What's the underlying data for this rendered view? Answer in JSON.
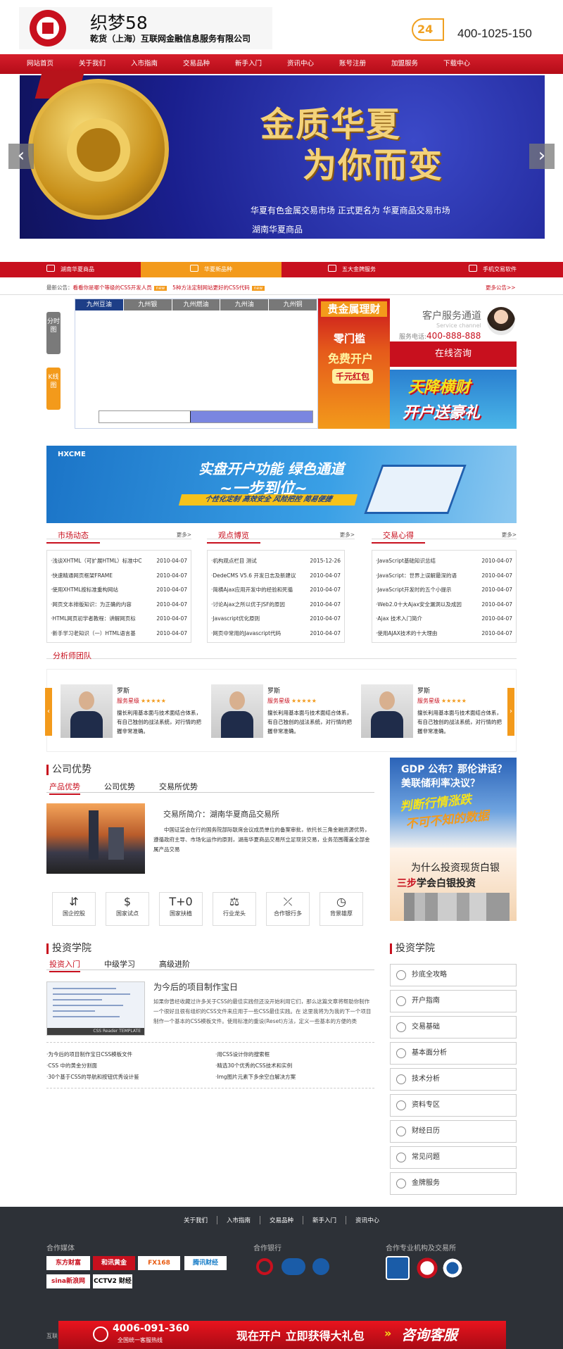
{
  "header": {
    "site_name": "织梦58",
    "company": "乾货（上海）互联网金融信息服务有限公司",
    "badge": "24",
    "hotline": "400-1025-150"
  },
  "nav": [
    "网站首页",
    "关于我们",
    "入市指南",
    "交易品种",
    "新手入门",
    "资讯中心",
    "账号注册",
    "加盟服务",
    "下载中心"
  ],
  "banner": {
    "slogan_line1": "金质华夏",
    "slogan_line2": "为你而变",
    "line1": "华夏有色金属交易市场 正式更名为 华夏商品交易市场",
    "line2": "湖南华夏商品",
    "prev": "‹",
    "next": "›"
  },
  "tabs": [
    "湖南华夏商品",
    "华夏新品种",
    "五大金牌服务",
    "手机交易软件"
  ],
  "notice": {
    "label": "最新公告：",
    "item1": "看看你是哪个等级的CSS开发人员",
    "badge": "new",
    "item2": "5种方法定制网站更好的CSS代码",
    "more": "更多公告>>"
  },
  "chart_side": {
    "btn1": "分时图",
    "btn2": "K线图"
  },
  "quote_tabs": [
    "九州豆油",
    "九州银",
    "九州燃油",
    "九州油",
    "九州铜"
  ],
  "ad_gold": {
    "title": "贵金属理财",
    "t2": "零门槛",
    "t3": "免费开户",
    "t4": "千元红包"
  },
  "service": {
    "title": "客户服务通道",
    "sub": "Service channel",
    "tel_label": "服务电话:",
    "tel": "400-888-888",
    "consult": "在线咨询"
  },
  "ad_tianjiang": {
    "t1": "天降横财",
    "t2": "开户送豪礼"
  },
  "ad_blue": {
    "logo": "HXCME",
    "t1": "实盘开户功能 绿色通道",
    "t2": "~一步到位~",
    "t3": "个性化定制 高效安全 风险把控 简易便捷"
  },
  "columns": [
    {
      "title": "市场动态",
      "more": "更多>",
      "items": [
        {
          "t": "·浅谈XHTML（可扩展HTML）标准中C",
          "d": "2010-04-07"
        },
        {
          "t": "·快速精通网页框架FRAME",
          "d": "2010-04-07"
        },
        {
          "t": "·使用XHTML按标准重构网站",
          "d": "2010-04-07"
        },
        {
          "t": "·网页文本排版知识：为正确的内容",
          "d": "2010-04-07"
        },
        {
          "t": "·HTML网页初学者教程：讲解网页标",
          "d": "2010-04-07"
        },
        {
          "t": "·新手学习老知识（一）HTML语言基",
          "d": "2010-04-07"
        }
      ]
    },
    {
      "title": "观点博览",
      "more": "更多>",
      "items": [
        {
          "t": "·机构观点栏目 测试",
          "d": "2015-12-26"
        },
        {
          "t": "·DedeCMS V5.6 开发日志及新建议",
          "d": "2010-04-07"
        },
        {
          "t": "·简横Ajax应用开发中的经验和死循",
          "d": "2010-04-07"
        },
        {
          "t": "·讨论Ajax之所以优于JSF的原因",
          "d": "2010-04-07"
        },
        {
          "t": "·Javascript优化原则",
          "d": "2010-04-07"
        },
        {
          "t": "·网页中常用的Javascript代码",
          "d": "2010-04-07"
        }
      ]
    },
    {
      "title": "交易心得",
      "more": "更多>",
      "items": [
        {
          "t": "·JavaScript基础知识总结",
          "d": "2010-04-07"
        },
        {
          "t": "·JavaScript：世界上误解最深的语",
          "d": "2010-04-07"
        },
        {
          "t": "·JavaScript开发时的五个小提示",
          "d": "2010-04-07"
        },
        {
          "t": "·Web2.0十大Ajax安全漏洞以及成因",
          "d": "2010-04-07"
        },
        {
          "t": "·Ajax 技术入门简介",
          "d": "2010-04-07"
        },
        {
          "t": "·使用AJAX技术的十大理由",
          "d": "2010-04-07"
        }
      ]
    }
  ],
  "analysts": {
    "title": "分析师团队",
    "prev": "‹",
    "next": "›",
    "items": [
      {
        "name": "罗斯",
        "level": "服务星级",
        "stars": "★★★★★",
        "desc": "擅长利用基本面与技术面结合体系，有自己独创的战法系统，对行情的把握非常准确。"
      },
      {
        "name": "罗斯",
        "level": "服务星级",
        "stars": "★★★★★",
        "desc": "擅长利用基本面与技术面结合体系，有自己独创的战法系统，对行情的把握非常准确。"
      },
      {
        "name": "罗斯",
        "level": "服务星级",
        "stars": "★★★★★",
        "desc": "擅长利用基本面与技术面结合体系，有自己独创的战法系统，对行情的把握非常准确。"
      }
    ]
  },
  "advantage": {
    "title": "公司优势",
    "tabs": [
      "产品优势",
      "公司优势",
      "交易所优势"
    ],
    "heading": "交易所简介：湖南华夏商品交易所",
    "text": "中国证监会在行的国务院部际联席会议成员单位的备案审批，依托长三角金融资源优势，遵循政府主导、市场化运作的原则，湖南华夏商品交易所立足现货交易，业务范围覆盖全部金属产品交易",
    "features": [
      {
        "icon": "⇵",
        "label": "国企控股"
      },
      {
        "icon": "$",
        "label": "国家试点"
      },
      {
        "icon": "T+0",
        "label": "国家扶植"
      },
      {
        "icon": "⚖",
        "label": "行业龙头"
      },
      {
        "icon": "⤫",
        "label": "合作银行多"
      },
      {
        "icon": "◷",
        "label": "背景雄厚"
      }
    ]
  },
  "right_ads": {
    "gdp_t1": "GDP 公布？那伦讲话？",
    "gdp_t2": "美联储利率决议？",
    "gdp_t3": "判断行情涨跌",
    "gdp_t4": "不可不知的数据",
    "silver_t1": "为什么投资现货白银",
    "silver_t2a": "三步",
    "silver_t2b": "学会白银投资"
  },
  "invest": {
    "title": "投资学院",
    "tabs": [
      "投资入门",
      "中级学习",
      "高级进阶"
    ],
    "img_caption": "CSS Reader TEMPLATE",
    "heading": "为今后的项目制作宝日",
    "text": "如果你曾经收藏过许多关于CSS的最佳实践但还没开始利用它们，那么这篇文章将帮助你制作一个很好且很有组织的CSS文件来应用于一些CSS最佳实践。在 这里我将为为我的下一个项目制作一个基本的CSS模板文件。使用标准的重设(Reset)方法，定义一些基本的方便的类",
    "links": [
      "·为今后的项目制作宝日CSS模板文件",
      "·用CSS设计你的搜索框",
      "·CSS 中的黄金分割面",
      "·精选30个优秀的CSS技术和实例",
      "·30个基于CSS的导航和按钮优秀设计鉴",
      "·Img图片元素下多余空白解决方案"
    ]
  },
  "side_menu": {
    "title": "投资学院",
    "items": [
      "抄底全攻略",
      "开户指南",
      "交易基础",
      "基本面分析",
      "技术分析",
      "资料专区",
      "财经日历",
      "常见问题",
      "金牌服务"
    ]
  },
  "footer": {
    "nav": [
      "关于我们",
      "入市指南",
      "交易品种",
      "新手入门",
      "资讯中心"
    ],
    "media_title": "合作媒体",
    "media": [
      "东方财富",
      "和讯黄金",
      "FX168",
      "腾讯财经",
      "sina新浪网",
      "CCTV2 财经"
    ],
    "bank_title": "合作银行",
    "org_title": "合作专业机构及交易所",
    "bar_phone": "4006-091-360",
    "bar_phone_sub": "全国统一客服热线",
    "bar_cta": "现在开户 立即获得大礼包",
    "bar_arrows": "»",
    "bar_consult": "咨询客服",
    "copy": "互联"
  }
}
